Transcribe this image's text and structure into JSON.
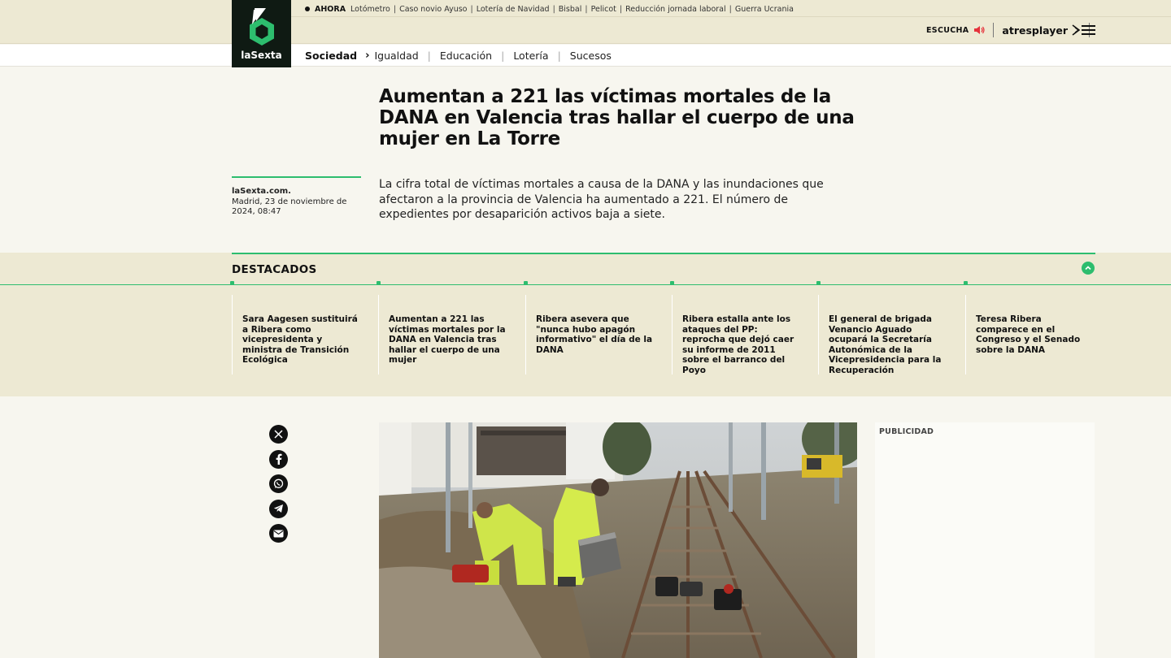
{
  "brand": {
    "logo_text": "laSexta",
    "accent": "#2dbd6e",
    "logo_bg": "#0f1a13"
  },
  "ahora": {
    "label": "AHORA",
    "items": [
      "Lotómetro",
      "Caso novio Ayuso",
      "Lotería de Navidad",
      "Bisbal",
      "Pelicot",
      "Reducción jornada laboral",
      "Guerra Ucrania"
    ]
  },
  "tools": {
    "escucha": "ESCUCHA",
    "escucha_icon": "speaker-icon",
    "atresplayer": "atresplayer",
    "menu_icon": "hamburger-menu-icon"
  },
  "nav": {
    "section": "Sociedad",
    "links": [
      "Igualdad",
      "Educación",
      "Lotería",
      "Sucesos"
    ]
  },
  "article": {
    "headline": "Aumentan a 221 las víctimas mortales de la DANA en Valencia tras hallar el cuerpo de una mujer en La Torre",
    "source": "laSexta.com.",
    "dateline": "Madrid, 23 de noviembre de 2024, 08:47",
    "lead": "La cifra total de víctimas mortales a causa de la DANA y las inundaciones que afectaron a la provincia de Valencia ha aumentado a 221. El número de expedientes por desaparición activos baja a siete."
  },
  "destacados": {
    "title": "DESTACADOS",
    "items": [
      "Sara Aagesen sustituirá a Ribera como vicepresidenta y ministra de Transición Ecológica",
      "Aumentan a 221 las víctimas mortales por la DANA en Valencia tras hallar el cuerpo de una mujer",
      "Ribera asevera que \"nunca hubo apagón informativo\" el día de la DANA",
      "Ribera estalla ante los ataques del PP: reprocha que dejó caer su informe de 2011 sobre el barranco del Poyo",
      "El general de brigada Venancio Aguado ocupará la Secretaría Autonómica de la Vicepresidencia para la Recuperación",
      "Teresa Ribera comparece en el Congreso y el Senado sobre la DANA"
    ]
  },
  "share": {
    "icons": [
      "x-icon",
      "facebook-icon",
      "whatsapp-icon",
      "telegram-icon",
      "email-icon"
    ]
  },
  "ad": {
    "label": "PUBLICIDAD"
  }
}
